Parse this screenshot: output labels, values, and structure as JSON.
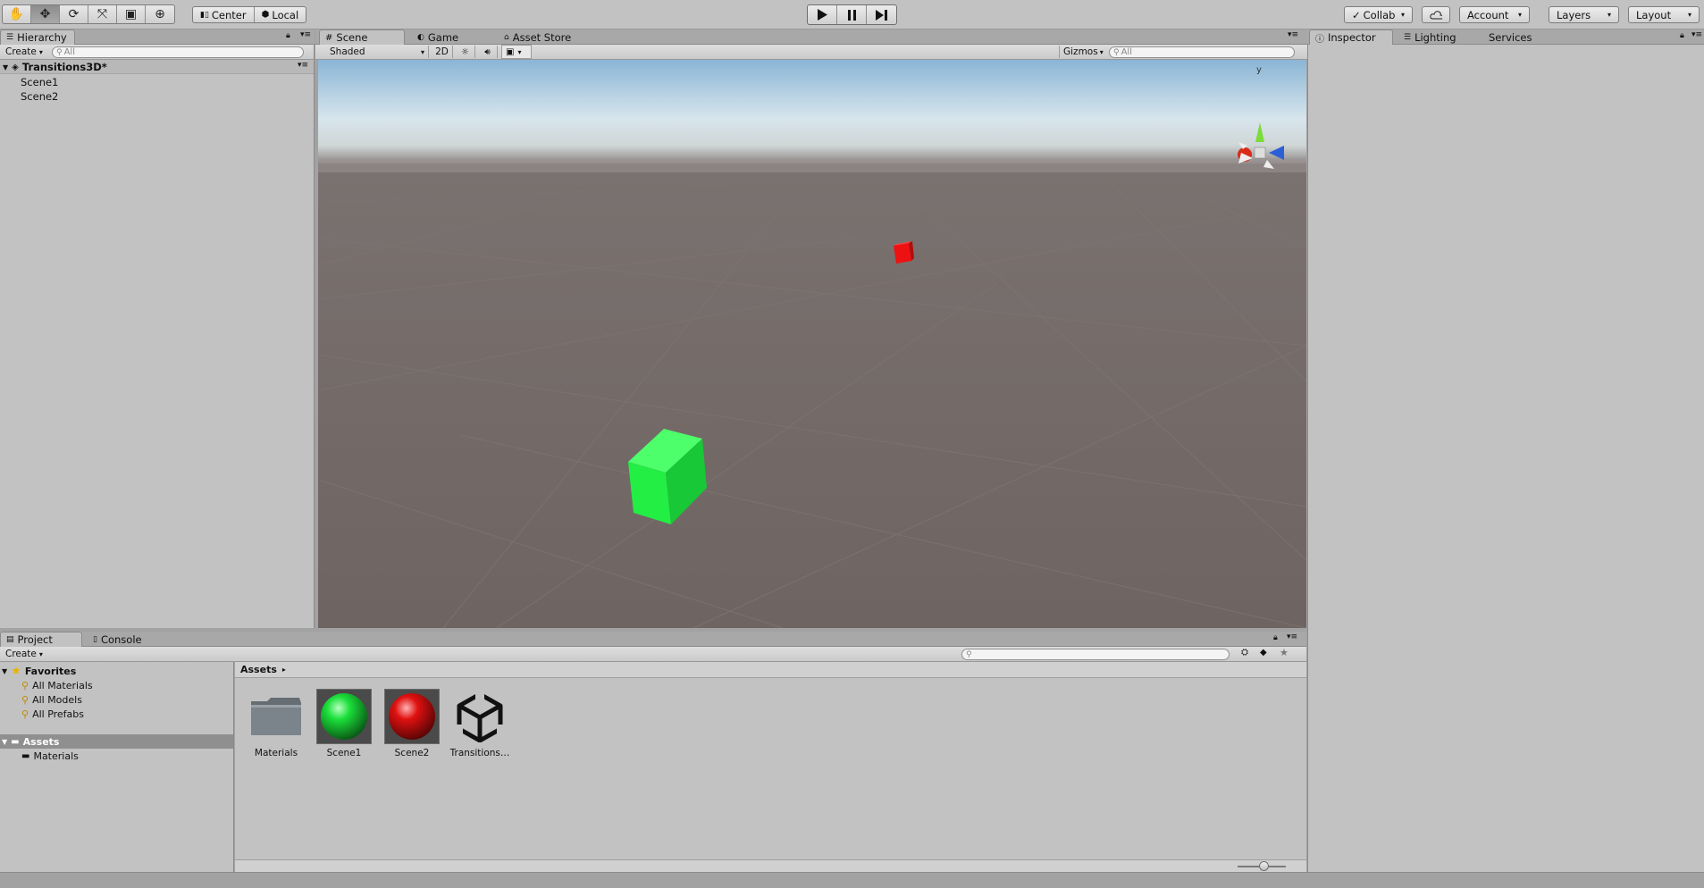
{
  "toolbar": {
    "tools": [
      "hand-icon",
      "move-icon",
      "rotate-icon",
      "scale-icon",
      "rect-icon",
      "transform-icon"
    ],
    "pivot_center": "Center",
    "pivot_local": "Local",
    "collab": "Collab",
    "account": "Account",
    "layers": "Layers",
    "layout": "Layout"
  },
  "hierarchy": {
    "tab": "Hierarchy",
    "create": "Create",
    "search_placeholder": "All",
    "scene_name": "Transitions3D*",
    "items": [
      {
        "label": "Scene1"
      },
      {
        "label": "Scene2"
      }
    ]
  },
  "scene": {
    "tabs": [
      {
        "label": "Scene"
      },
      {
        "label": "Game"
      },
      {
        "label": "Asset Store"
      }
    ],
    "shading_mode": "Shaded",
    "mode_2d": "2D",
    "gizmos": "Gizmos",
    "search_placeholder": "All",
    "gizmo_axis_y": "y",
    "colors": {
      "green_cube": "#22ee44",
      "red_cube": "#ee1111",
      "ground": "#6e6462"
    }
  },
  "inspector": {
    "tabs": [
      {
        "label": "Inspector"
      },
      {
        "label": "Lighting"
      },
      {
        "label": "Services"
      }
    ]
  },
  "project": {
    "tabs": [
      {
        "label": "Project"
      },
      {
        "label": "Console"
      }
    ],
    "create": "Create",
    "favorites_label": "Favorites",
    "favorites": [
      {
        "label": "All Materials"
      },
      {
        "label": "All Models"
      },
      {
        "label": "All Prefabs"
      }
    ],
    "assets_root": "Assets",
    "assets_children": [
      {
        "label": "Materials"
      }
    ],
    "breadcrumb": "Assets",
    "assets": [
      {
        "label": "Materials",
        "kind": "folder-icon"
      },
      {
        "label": "Scene1",
        "kind": "material-green"
      },
      {
        "label": "Scene2",
        "kind": "material-red"
      },
      {
        "label": "Transitions…",
        "kind": "unity-scene-icon"
      }
    ]
  }
}
